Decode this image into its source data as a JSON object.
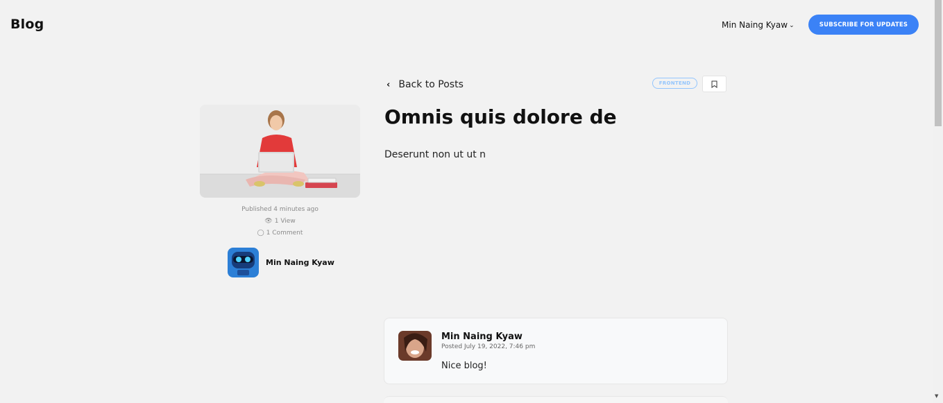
{
  "header": {
    "logo": "Blog",
    "user_name": "Min Naing Kyaw",
    "subscribe_label": "SUBSCRIBE FOR UPDATES"
  },
  "post": {
    "back_label": "Back to Posts",
    "tag": "FRONTEND",
    "title": "Omnis quis dolore de",
    "body": "Deserunt non ut ut n",
    "published": "Published 4 minutes ago",
    "views": "1 View",
    "comments": "1 Comment",
    "author_name": "Min Naing Kyaw"
  },
  "comments": [
    {
      "author": "Min Naing Kyaw",
      "date": "Posted July 19, 2022, 7:46 pm",
      "text": "Nice blog!"
    }
  ],
  "colors": {
    "accent": "#3b82f6",
    "background": "#f2f2f2",
    "tag_border": "#93c5fd"
  },
  "icons": {
    "back": "chevron-left-icon",
    "bookmark": "bookmark-icon",
    "views": "eye-icon",
    "comments": "comment-bubble-icon",
    "user_menu": "chevron-down-icon"
  }
}
